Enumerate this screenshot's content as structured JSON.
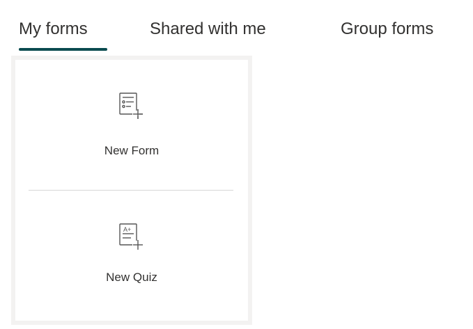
{
  "tabs": [
    {
      "label": "My forms",
      "selected": true
    },
    {
      "label": "Shared with me",
      "selected": false
    },
    {
      "label": "Group forms",
      "selected": false
    }
  ],
  "create": {
    "new_form_label": "New Form",
    "new_form_icon": "new-form-icon",
    "new_quiz_label": "New Quiz",
    "new_quiz_icon": "new-quiz-icon",
    "quiz_icon_text": "A+"
  },
  "colors": {
    "tab_underline": "#0b4b50",
    "panel_background": "#f3f2f1",
    "text": "#323130"
  }
}
